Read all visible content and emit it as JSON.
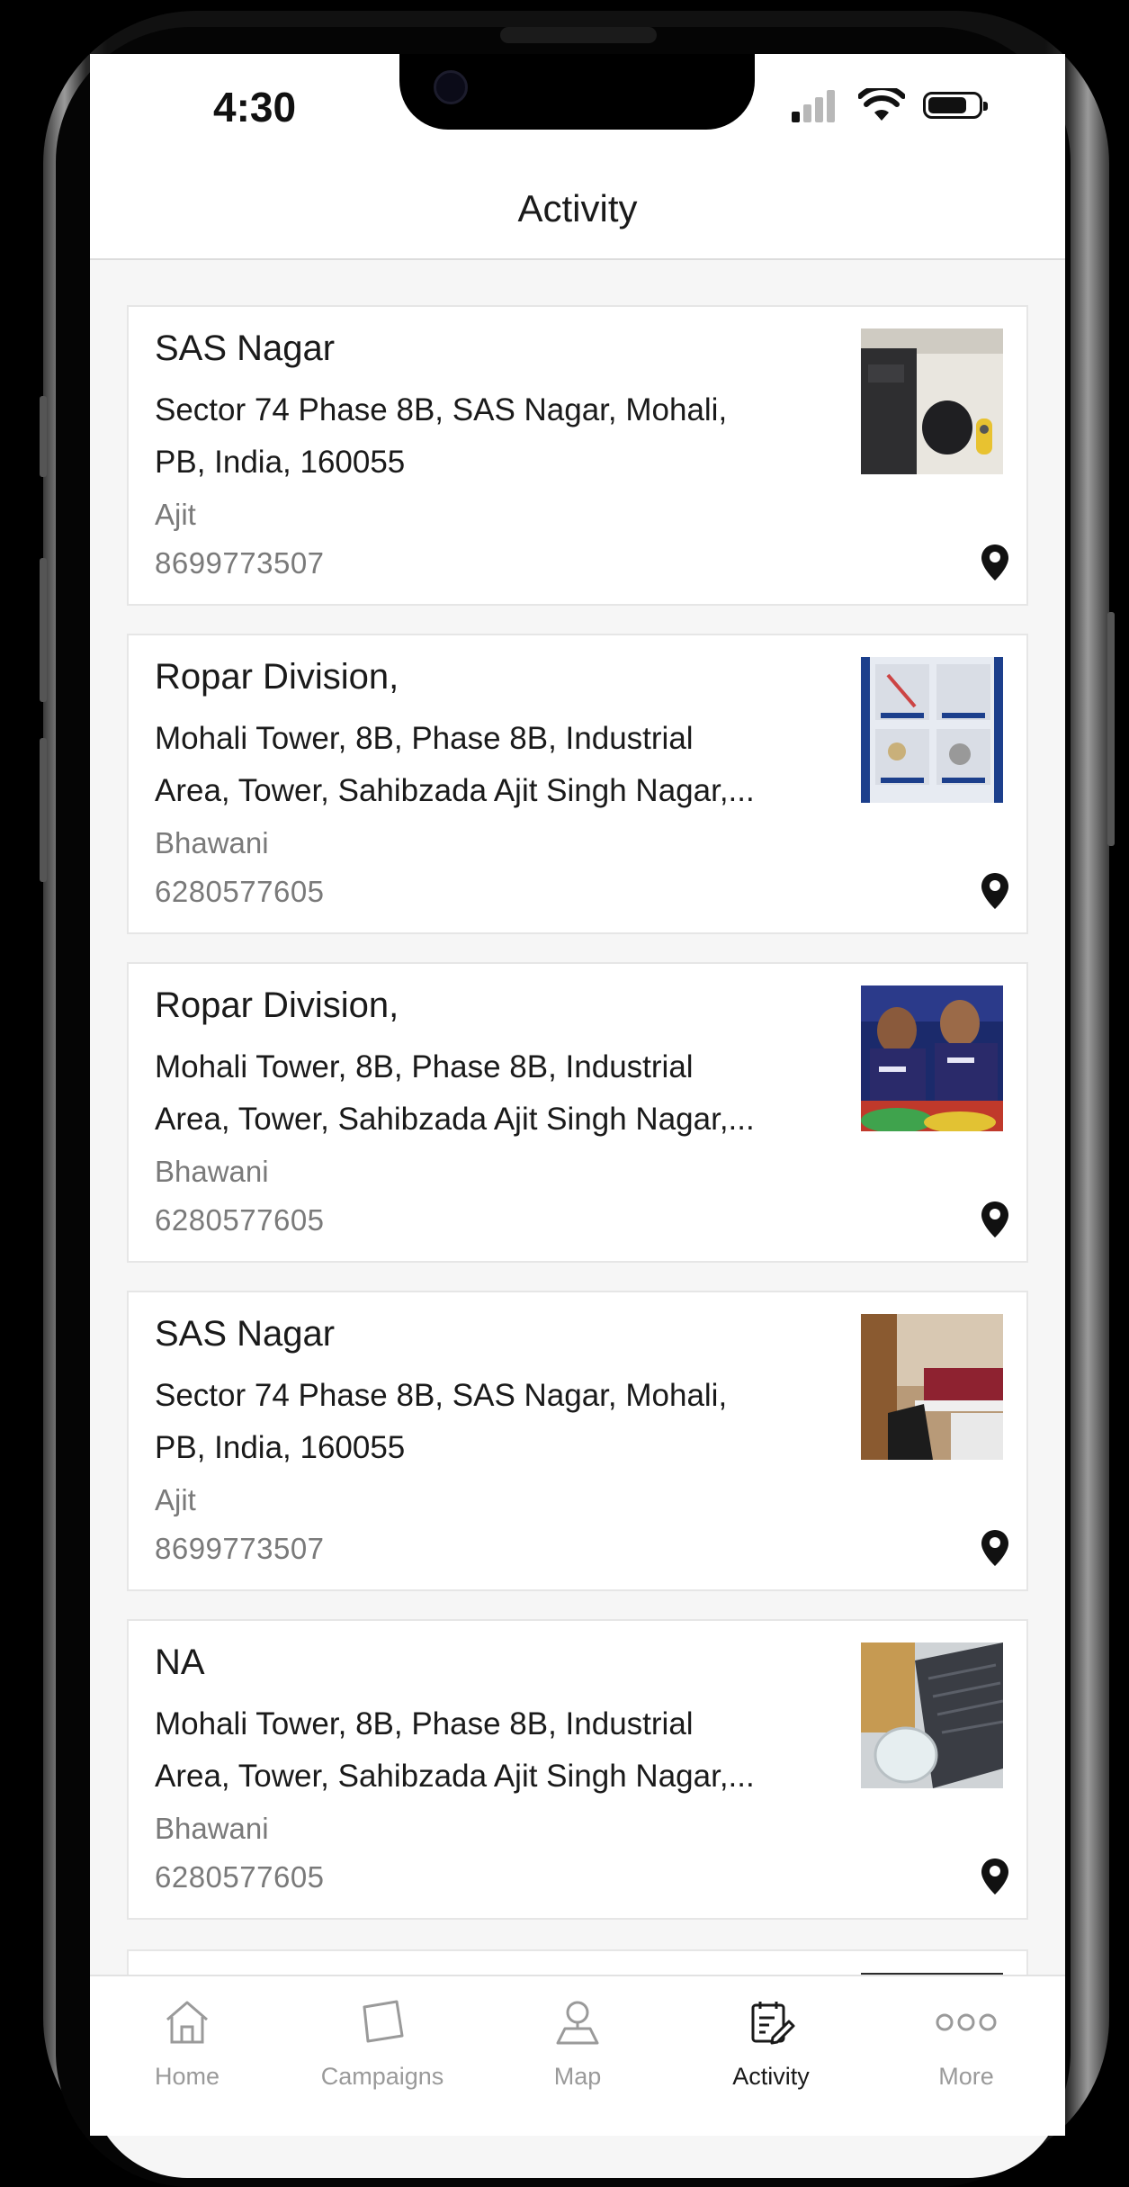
{
  "status_bar": {
    "time": "4:30"
  },
  "header": {
    "title": "Activity"
  },
  "cards": [
    {
      "title": "SAS Nagar",
      "address_line1": "Sector 74 Phase 8B, SAS Nagar, Mohali,",
      "address_line2": "PB, India, 160055",
      "person": "Ajit",
      "phone": "8699773507",
      "thumbnail": "laptop-desk-photo"
    },
    {
      "title": "Ropar Division,",
      "address_line1": "Mohali Tower, 8B, Phase 8B, Industrial",
      "address_line2": "Area, Tower, Sahibzada Ajit Singh Nagar,...",
      "person": "Bhawani",
      "phone": "6280577605",
      "thumbnail": "cable-catalog-photo"
    },
    {
      "title": "Ropar Division,",
      "address_line1": "Mohali Tower, 8B, Phase 8B, Industrial",
      "address_line2": "Area, Tower, Sahibzada Ajit Singh Nagar,...",
      "person": "Bhawani",
      "phone": "6280577605",
      "thumbnail": "cricket-poster-photo"
    },
    {
      "title": "SAS Nagar",
      "address_line1": "Sector 74 Phase 8B, SAS Nagar, Mohali,",
      "address_line2": "PB, India, 160055",
      "person": "Ajit",
      "phone": "8699773507",
      "thumbnail": "office-room-photo"
    },
    {
      "title": "NA",
      "address_line1": "Mohali Tower, 8B, Phase 8B, Industrial",
      "address_line2": "Area, Tower, Sahibzada Ajit Singh Nagar,...",
      "person": "Bhawani",
      "phone": "6280577605",
      "thumbnail": "glass-keyboard-photo"
    }
  ],
  "tabbar": {
    "items": [
      {
        "label": "Home",
        "icon": "home-icon",
        "active": false
      },
      {
        "label": "Campaigns",
        "icon": "campaigns-icon",
        "active": false
      },
      {
        "label": "Map",
        "icon": "map-pin-icon",
        "active": false
      },
      {
        "label": "Activity",
        "icon": "activity-icon",
        "active": true
      },
      {
        "label": "More",
        "icon": "more-icon",
        "active": false
      }
    ]
  },
  "colors": {
    "text": "#1a1a1a",
    "muted": "#7a7a7a",
    "inactive_tab": "#9a9a9a",
    "background": "#f6f6f6"
  }
}
